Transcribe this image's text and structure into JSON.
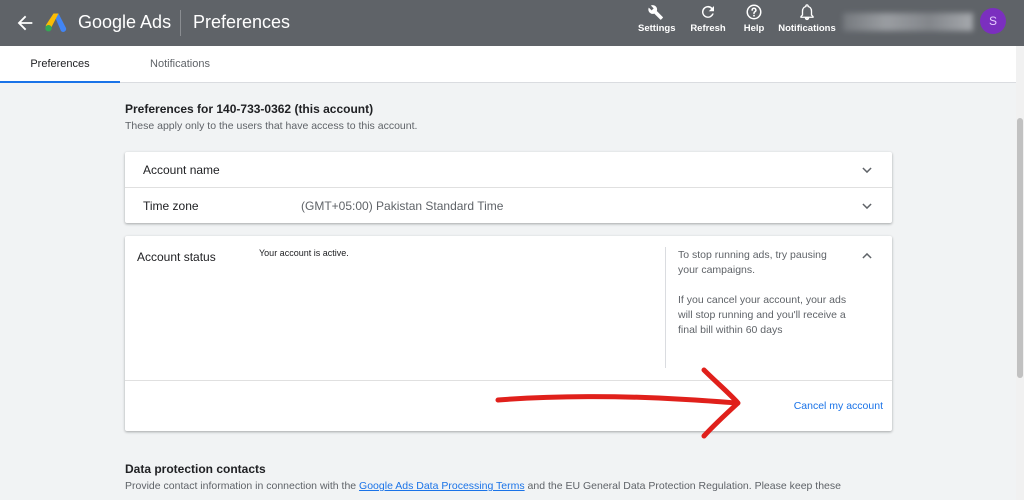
{
  "header": {
    "brand": "Google Ads",
    "page_title": "Preferences",
    "tools": [
      {
        "label": "Settings",
        "icon": "wrench-icon"
      },
      {
        "label": "Refresh",
        "icon": "refresh-icon"
      },
      {
        "label": "Help",
        "icon": "help-icon"
      },
      {
        "label": "Notifications",
        "icon": "bell-icon"
      }
    ],
    "avatar_initial": "S"
  },
  "tabs": [
    {
      "label": "Preferences",
      "active": true
    },
    {
      "label": "Notifications",
      "active": false
    }
  ],
  "preferences": {
    "title": "Preferences for 140-733-0362 (this account)",
    "subtitle": "These apply only to the users that have access to this account.",
    "rows": [
      {
        "label": "Account name",
        "value": ""
      },
      {
        "label": "Time zone",
        "value": "(GMT+05:00) Pakistan Standard Time"
      }
    ]
  },
  "account_status": {
    "label": "Account status",
    "status": "Your account is active.",
    "note_1": "To stop running ads, try pausing your campaigns.",
    "note_2": "If you cancel your account, your ads will stop running and you'll receive a final bill within 60 days",
    "cancel_label": "Cancel my account"
  },
  "data_protection": {
    "title": "Data protection contacts",
    "text_before": "Provide contact information in connection with the ",
    "link": "Google Ads Data Processing Terms",
    "text_after": " and the EU General Data Protection Regulation. Please keep these"
  },
  "colors": {
    "appbar": "#5f6368",
    "accent": "#1a73e8",
    "annotation_arrow": "#e0201b",
    "avatar": "#7b2fbf"
  }
}
